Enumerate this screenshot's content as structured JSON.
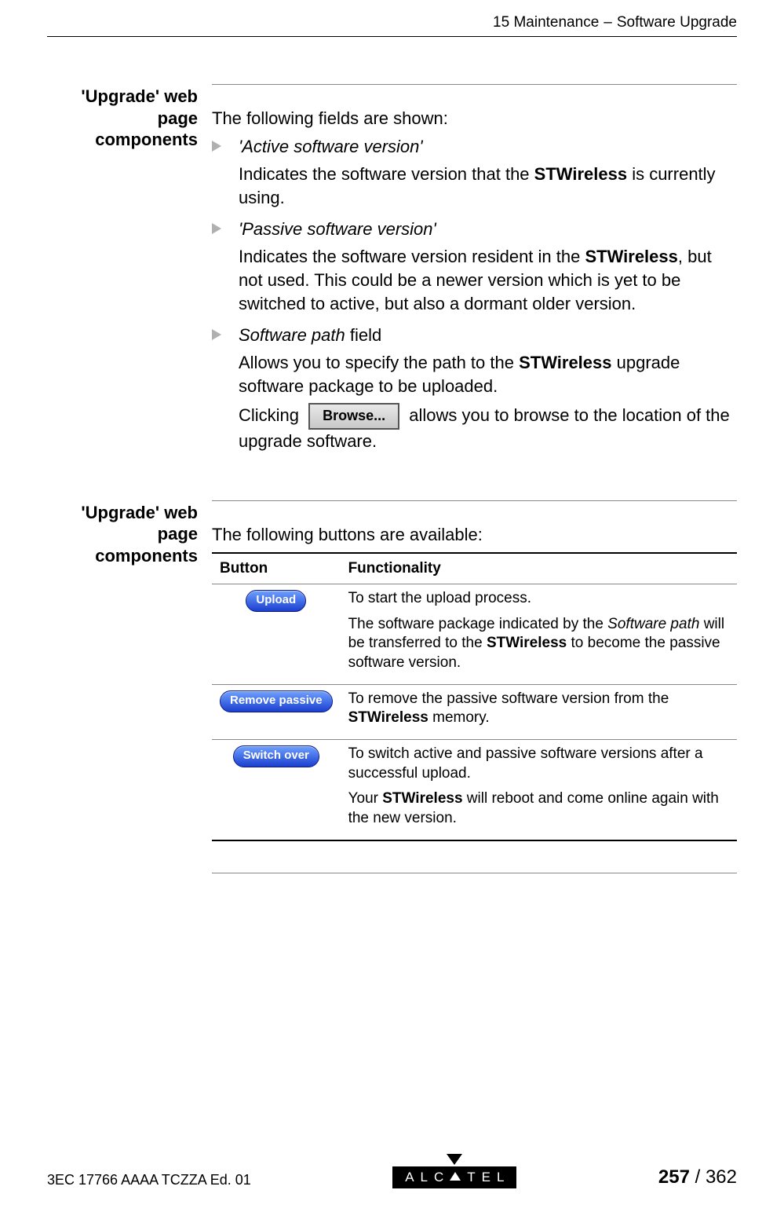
{
  "header": {
    "chapter": "15 Maintenance",
    "sep": "–",
    "section": "Software Upgrade"
  },
  "section1": {
    "label_l1": "'Upgrade' web page",
    "label_l2": "components",
    "intro": "The following fields are shown:",
    "items": [
      {
        "title": "'Active software version'",
        "desc_pre": "Indicates the software version that the ",
        "desc_bold": "STWireless",
        "desc_post": " is currently using."
      },
      {
        "title": "'Passive software version'",
        "desc_pre": "Indicates the software version resident in the ",
        "desc_bold": "STWireless",
        "desc_post": ", but not used. This could be a newer version which is yet to be switched to active, but also a dormant older version."
      },
      {
        "title_italic": "Software path",
        "title_rest": " field",
        "desc_pre": "Allows you to specify the path to the ",
        "desc_bold": "STWireless",
        "desc_post": " upgrade software package to be uploaded.",
        "click_pre": "Clicking ",
        "browse_label": "Browse...",
        "click_post": " allows you to browse to the location of the upgrade software."
      }
    ]
  },
  "section2": {
    "label_l1": "'Upgrade' web page",
    "label_l2": "components",
    "intro": "The following buttons are available:",
    "table": {
      "h1": "Button",
      "h2": "Functionality",
      "rows": [
        {
          "btn": "Upload",
          "p1": "To start the upload process.",
          "p2_pre": "The software package indicated by the ",
          "p2_it": "Software path",
          "p2_mid": " will be transferred to the ",
          "p2_bold": "STWireless",
          "p2_post": " to become the passive software version."
        },
        {
          "btn": "Remove passive",
          "p1_pre": "To remove the passive software version from the ",
          "p1_bold": "STWireless",
          "p1_post": " memory."
        },
        {
          "btn": "Switch over",
          "p1": "To switch active and passive software versions after a successful upload.",
          "p2_pre": "Your ",
          "p2_bold": "STWireless",
          "p2_post": " will reboot and come online again with the new version."
        }
      ]
    }
  },
  "footer": {
    "left": "3EC 17766 AAAA TCZZA Ed. 01",
    "brand_pre": "ALC",
    "brand_post": "TEL",
    "page_cur": "257",
    "page_sep": " / ",
    "page_total": "362"
  }
}
